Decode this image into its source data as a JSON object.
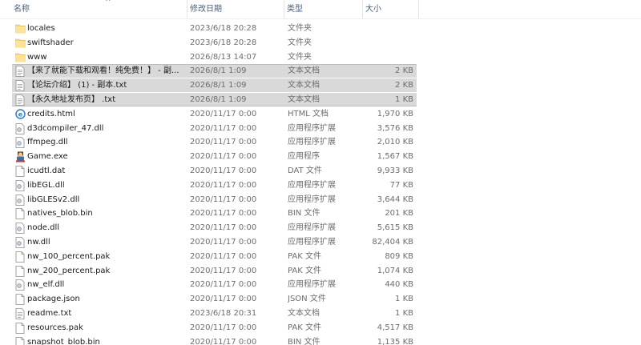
{
  "headers": {
    "name": "名称",
    "date": "修改日期",
    "type": "类型",
    "size": "大小"
  },
  "colors": {
    "selection": "#d9d9d9",
    "folder": "#f8d775",
    "header_text": "#4c607a",
    "secondary_text": "#6d6d6d"
  },
  "files": [
    {
      "name": "locales",
      "date": "2023/6/18 20:28",
      "type": "文件夹",
      "size": "",
      "icon": "folder-icon",
      "selected": false
    },
    {
      "name": "swiftshader",
      "date": "2023/6/18 20:28",
      "type": "文件夹",
      "size": "",
      "icon": "folder-icon",
      "selected": false
    },
    {
      "name": "www",
      "date": "2026/8/13 14:07",
      "type": "文件夹",
      "size": "",
      "icon": "folder-icon",
      "selected": false
    },
    {
      "name": "【来了就能下载和观看！纯免费！】 - 副...",
      "date": "2026/8/1 1:09",
      "type": "文本文档",
      "size": "2 KB",
      "icon": "text-file-icon",
      "selected": true
    },
    {
      "name": "【论坛介绍】 (1) - 副本.txt",
      "date": "2026/8/1 1:09",
      "type": "文本文档",
      "size": "2 KB",
      "icon": "text-file-icon",
      "selected": true
    },
    {
      "name": "【永久地址发布页】 .txt",
      "date": "2026/8/1 1:09",
      "type": "文本文档",
      "size": "1 KB",
      "icon": "text-file-icon",
      "selected": true
    },
    {
      "name": "credits.html",
      "date": "2020/11/17 0:00",
      "type": "HTML 文档",
      "size": "1,970 KB",
      "icon": "html-file-icon",
      "selected": false
    },
    {
      "name": "d3dcompiler_47.dll",
      "date": "2020/11/17 0:00",
      "type": "应用程序扩展",
      "size": "3,576 KB",
      "icon": "dll-file-icon",
      "selected": false
    },
    {
      "name": "ffmpeg.dll",
      "date": "2020/11/17 0:00",
      "type": "应用程序扩展",
      "size": "2,010 KB",
      "icon": "dll-file-icon",
      "selected": false
    },
    {
      "name": "Game.exe",
      "date": "2020/11/17 0:00",
      "type": "应用程序",
      "size": "1,567 KB",
      "icon": "game-exe-icon",
      "selected": false
    },
    {
      "name": "icudtl.dat",
      "date": "2020/11/17 0:00",
      "type": "DAT 文件",
      "size": "9,933 KB",
      "icon": "blank-file-icon",
      "selected": false
    },
    {
      "name": "libEGL.dll",
      "date": "2020/11/17 0:00",
      "type": "应用程序扩展",
      "size": "77 KB",
      "icon": "dll-file-icon",
      "selected": false
    },
    {
      "name": "libGLESv2.dll",
      "date": "2020/11/17 0:00",
      "type": "应用程序扩展",
      "size": "3,644 KB",
      "icon": "dll-file-icon",
      "selected": false
    },
    {
      "name": "natives_blob.bin",
      "date": "2020/11/17 0:00",
      "type": "BIN 文件",
      "size": "201 KB",
      "icon": "blank-file-icon",
      "selected": false
    },
    {
      "name": "node.dll",
      "date": "2020/11/17 0:00",
      "type": "应用程序扩展",
      "size": "5,615 KB",
      "icon": "dll-file-icon",
      "selected": false
    },
    {
      "name": "nw.dll",
      "date": "2020/11/17 0:00",
      "type": "应用程序扩展",
      "size": "82,404 KB",
      "icon": "dll-file-icon",
      "selected": false
    },
    {
      "name": "nw_100_percent.pak",
      "date": "2020/11/17 0:00",
      "type": "PAK 文件",
      "size": "809 KB",
      "icon": "blank-file-icon",
      "selected": false
    },
    {
      "name": "nw_200_percent.pak",
      "date": "2020/11/17 0:00",
      "type": "PAK 文件",
      "size": "1,074 KB",
      "icon": "blank-file-icon",
      "selected": false
    },
    {
      "name": "nw_elf.dll",
      "date": "2020/11/17 0:00",
      "type": "应用程序扩展",
      "size": "440 KB",
      "icon": "dll-file-icon",
      "selected": false
    },
    {
      "name": "package.json",
      "date": "2020/11/17 0:00",
      "type": "JSON 文件",
      "size": "1 KB",
      "icon": "blank-file-icon",
      "selected": false
    },
    {
      "name": "readme.txt",
      "date": "2023/6/18 20:31",
      "type": "文本文档",
      "size": "1 KB",
      "icon": "text-file-icon",
      "selected": false
    },
    {
      "name": "resources.pak",
      "date": "2020/11/17 0:00",
      "type": "PAK 文件",
      "size": "4,517 KB",
      "icon": "blank-file-icon",
      "selected": false
    },
    {
      "name": "snapshot_blob.bin",
      "date": "2020/11/17 0:00",
      "type": "BIN 文件",
      "size": "1,135 KB",
      "icon": "blank-file-icon",
      "selected": false
    }
  ]
}
